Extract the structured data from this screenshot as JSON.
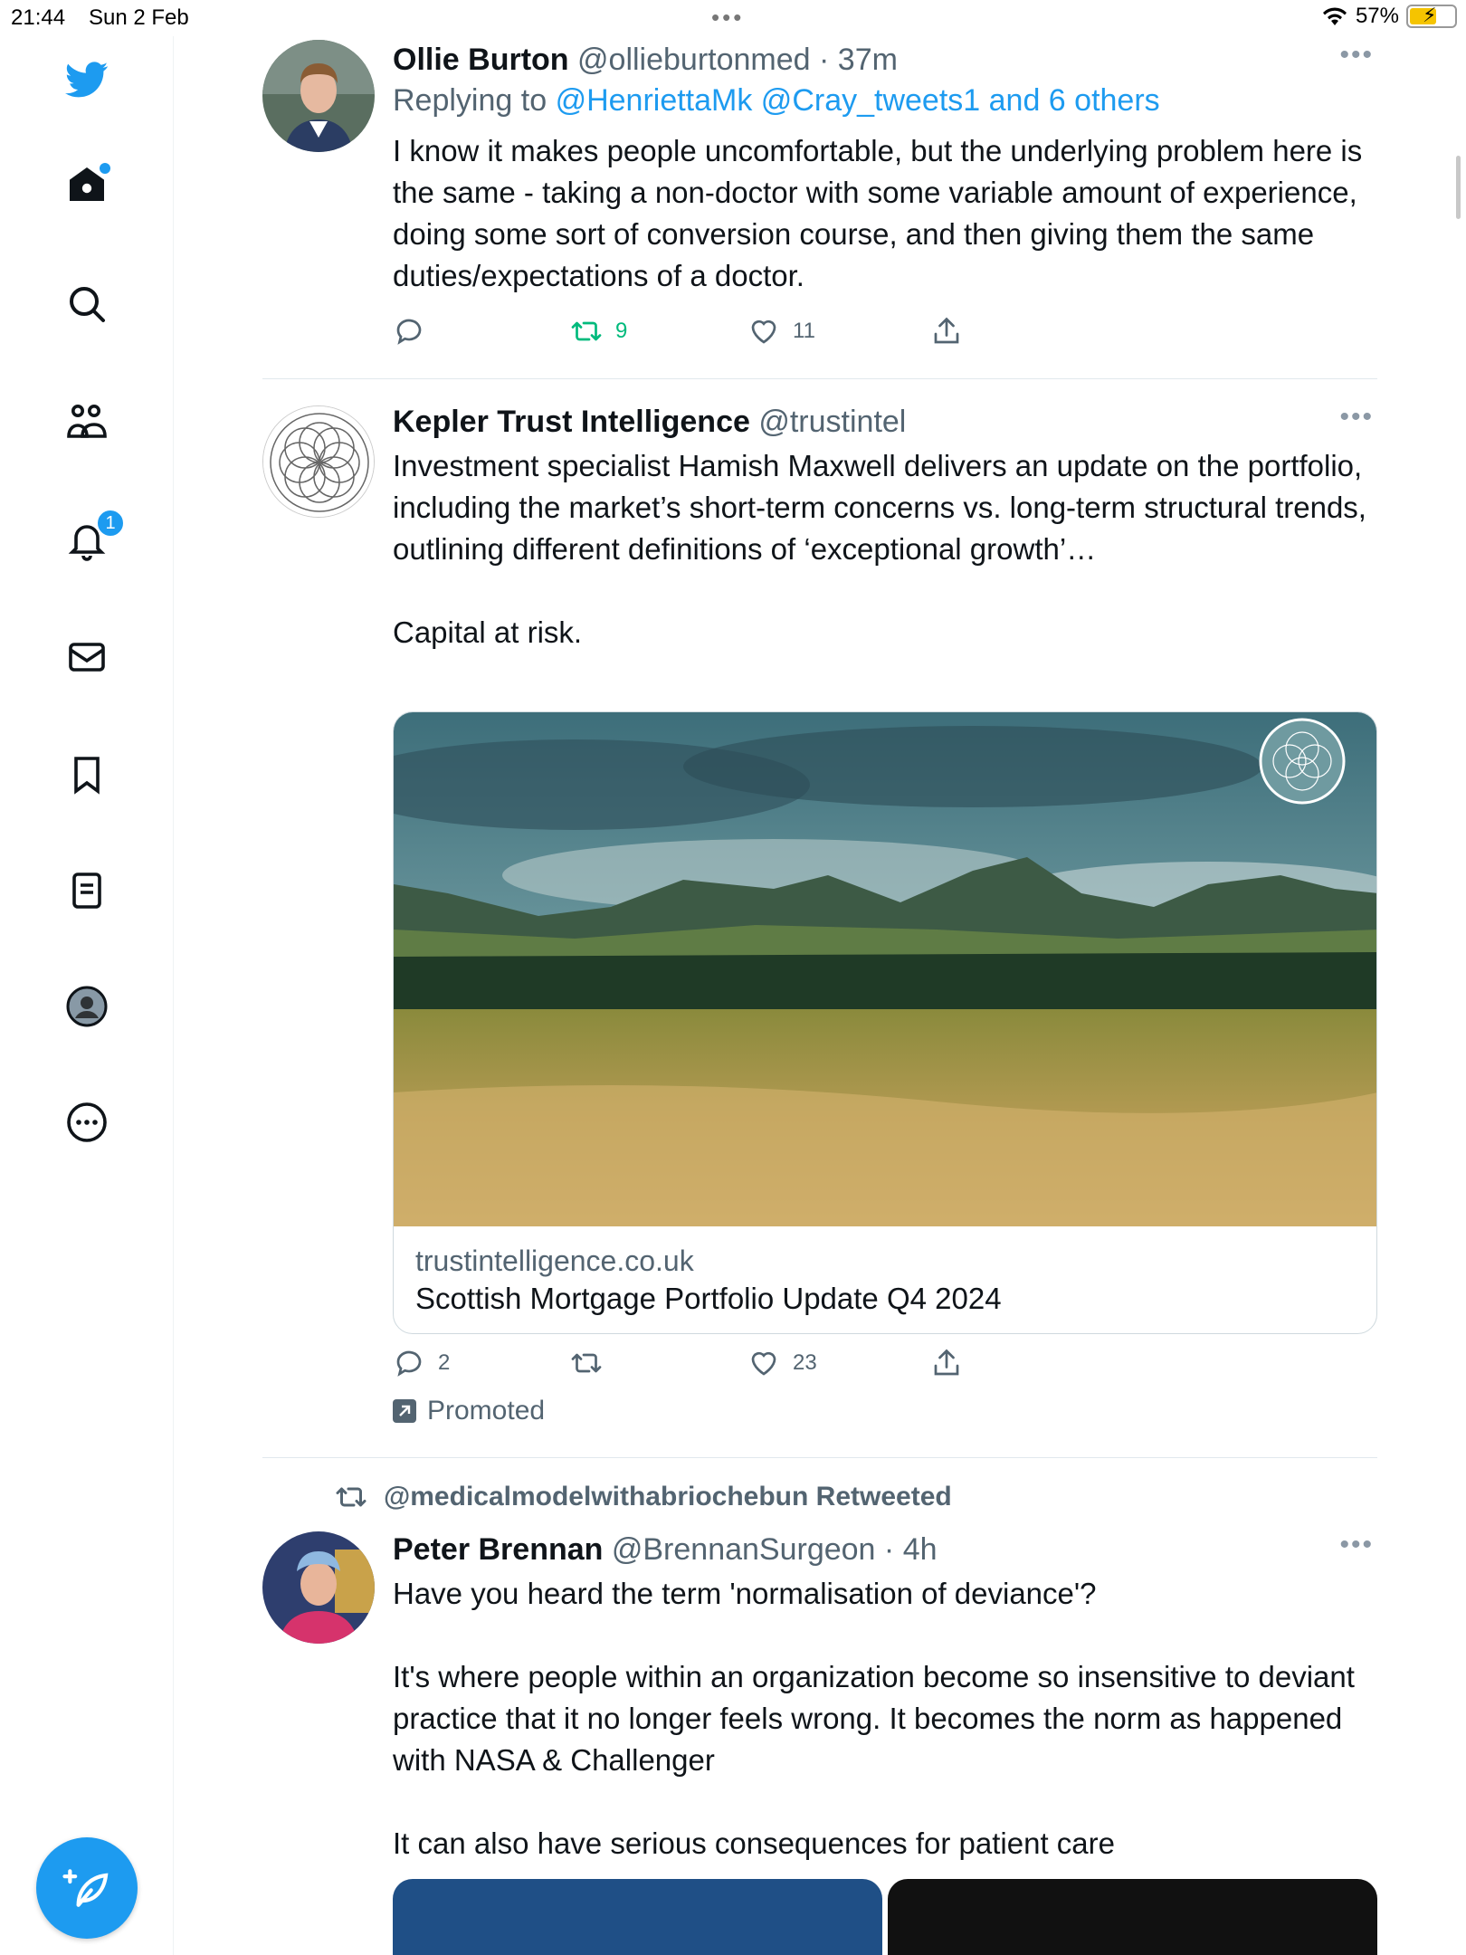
{
  "status_bar": {
    "time": "21:44",
    "date": "Sun 2 Feb",
    "battery": "57%"
  },
  "sidebar": {
    "notifications_badge": "1"
  },
  "tweets": [
    {
      "name": "Ollie Burton",
      "handle": "@ollieburtonmed",
      "time": "· 37m",
      "reply_prefix": "Replying to",
      "reply_to": "@HenriettaMk @Cray_tweets1 and 6 others",
      "text": "I know it makes people uncomfortable, but the underlying problem here is the same - taking a non-doctor with some variable amount of experience, doing some sort of conversion course, and then giving them the same duties/expectations of a doctor.",
      "retweets": "9",
      "likes": "11"
    },
    {
      "name": "Kepler Trust Intelligence",
      "handle": "@trustintel",
      "text": "Investment specialist Hamish Maxwell delivers an update on the portfolio, including the market’s short-term concerns vs. long-term structural trends, outlining different definitions of ‘exceptional growth’…\n\nCapital at risk.",
      "card_domain": "trustintelligence.co.uk",
      "card_title": "Scottish Mortgage Portfolio Update Q4 2024",
      "replies": "2",
      "likes": "23",
      "promoted": "Promoted"
    },
    {
      "retweeted_by": "@medicalmodelwithabriochebun Retweeted",
      "name": "Peter Brennan",
      "handle": "@BrennanSurgeon",
      "time": "· 4h",
      "text": "Have you heard the term 'normalisation of deviance'?\n\nIt's where people within an organization become so insensitive to deviant practice that it no longer feels wrong. It becomes the norm as happened with NASA & Challenger\n\nIt can also have serious consequences for patient care"
    }
  ],
  "colors": {
    "accent": "#1d9bf0",
    "retweet": "#00ba7c",
    "muted": "#536471"
  }
}
